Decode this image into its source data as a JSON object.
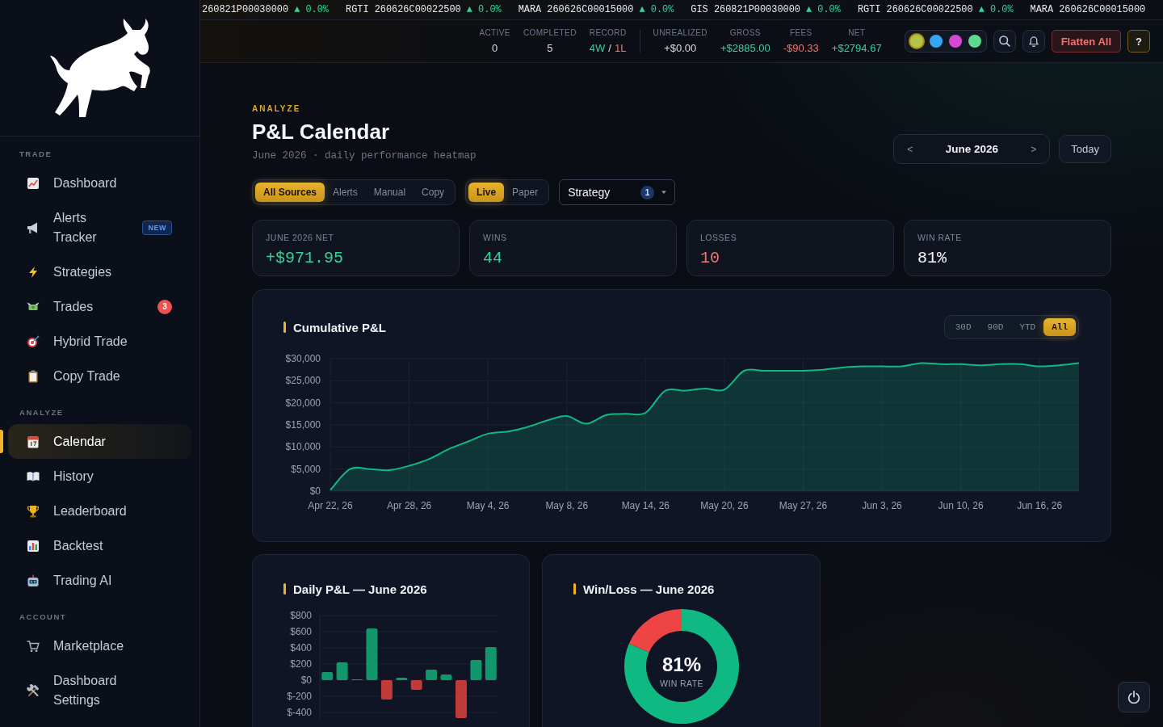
{
  "sidebar": {
    "sections": [
      {
        "title": "TRADE",
        "items": [
          {
            "label": "Dashboard",
            "selected": false
          },
          {
            "label": "Alerts Tracker",
            "selected": false,
            "badge": {
              "kind": "new",
              "text": "NEW"
            }
          },
          {
            "label": "Strategies",
            "selected": false
          },
          {
            "label": "Trades",
            "selected": false,
            "badge": {
              "kind": "count",
              "text": "3"
            }
          },
          {
            "label": "Hybrid Trade",
            "selected": false
          },
          {
            "label": "Copy Trade",
            "selected": false
          }
        ]
      },
      {
        "title": "ANALYZE",
        "items": [
          {
            "label": "Calendar",
            "selected": true
          },
          {
            "label": "History",
            "selected": false
          },
          {
            "label": "Leaderboard",
            "selected": false
          },
          {
            "label": "Backtest",
            "selected": false
          },
          {
            "label": "Trading AI",
            "selected": false
          }
        ]
      },
      {
        "title": "ACCOUNT",
        "items": [
          {
            "label": "Marketplace",
            "selected": false
          },
          {
            "label": "Dashboard Settings",
            "selected": false
          }
        ]
      }
    ]
  },
  "ticker": [
    {
      "label": "260821P00030000",
      "change": "▲ 0.0%"
    },
    {
      "label": "RGTI 260626C00022500",
      "change": "▲ 0.0%"
    },
    {
      "label": "MARA 260626C00015000",
      "change": "▲ 0.0%"
    },
    {
      "label": "GIS 260821P00030000",
      "change": "▲ 0.0%"
    },
    {
      "label": "RGTI 260626C00022500",
      "change": "▲ 0.0%"
    },
    {
      "label": "MARA 260626C00015000"
    }
  ],
  "header_stats": {
    "counts": [
      {
        "label": "ACTIVE",
        "value": "0"
      },
      {
        "label": "COMPLETED",
        "value": "5"
      },
      {
        "label": "RECORD",
        "parts": [
          {
            "text": "4W",
            "color": "#34d399"
          },
          {
            "text": "/"
          },
          {
            "text": "1L",
            "color": "#f87171"
          }
        ]
      }
    ],
    "pnl": [
      {
        "label": "UNREALIZED",
        "value": "+$0.00"
      },
      {
        "label": "GROSS",
        "value": "+$2885.00",
        "color": "#34d399"
      },
      {
        "label": "FEES",
        "value": "-$90.33",
        "color": "#f87171"
      },
      {
        "label": "NET",
        "value": "+$2794.67",
        "color": "#34d399"
      }
    ]
  },
  "theme_swatches": [
    {
      "color": "#b3c44a",
      "selected": true
    },
    {
      "color": "#38a6f2",
      "selected": false
    },
    {
      "color": "#d548d6",
      "selected": false
    },
    {
      "color": "#5fd98f",
      "selected": false
    }
  ],
  "header_actions": {
    "flatten": "Flatten All",
    "help": "?"
  },
  "page": {
    "eyebrow": "ANALYZE",
    "title": "P&L Calendar",
    "subtitle": "June 2026 · daily performance heatmap"
  },
  "month_nav": {
    "prev": "<",
    "label": "June 2026",
    "next": ">",
    "today": "Today"
  },
  "source_filter": [
    {
      "label": "All Sources",
      "selected": true
    },
    {
      "label": "Alerts",
      "selected": false
    },
    {
      "label": "Manual",
      "selected": false
    },
    {
      "label": "Copy",
      "selected": false
    }
  ],
  "mode_filter": [
    {
      "label": "Live",
      "selected": true
    },
    {
      "label": "Paper",
      "selected": false
    }
  ],
  "strategy_select": {
    "label": "Strategy",
    "count": "1"
  },
  "kpis": [
    {
      "label": "JUNE 2026 NET",
      "value": "+$971.95",
      "color": "#34d399"
    },
    {
      "label": "WINS",
      "value": "44",
      "color": "#34d399"
    },
    {
      "label": "LOSSES",
      "value": "10",
      "color": "#f87171"
    },
    {
      "label": "WIN RATE",
      "value": "81%",
      "color": "#f4f6f9"
    }
  ],
  "cumulative_chart": {
    "title": "Cumulative P&L",
    "ranges": [
      {
        "label": "30D",
        "selected": false
      },
      {
        "label": "90D",
        "selected": false
      },
      {
        "label": "YTD",
        "selected": false
      },
      {
        "label": "All",
        "selected": true
      }
    ],
    "chart_data": {
      "type": "area",
      "grid": true,
      "categories": [
        "Apr 22, 26",
        null,
        null,
        null,
        "Apr 28, 26",
        null,
        null,
        null,
        "May 4, 26",
        null,
        null,
        null,
        "May 8, 26",
        null,
        null,
        null,
        "May 14, 26",
        null,
        null,
        null,
        "May 20, 26",
        null,
        null,
        null,
        "May 27, 26",
        null,
        null,
        null,
        "Jun 3, 26",
        null,
        null,
        null,
        "Jun 10, 26",
        null,
        null,
        null,
        "Jun 16, 26",
        null,
        null
      ],
      "ylim": [
        0,
        30000
      ],
      "yticks": [
        {
          "value": 0,
          "label": "$0"
        },
        {
          "value": 5000,
          "label": "$5,000"
        },
        {
          "value": 10000,
          "label": "$10,000"
        },
        {
          "value": 15000,
          "label": "$15,000"
        },
        {
          "value": 20000,
          "label": "$20,000"
        },
        {
          "value": 25000,
          "label": "$25,000"
        },
        {
          "value": 30000,
          "label": "$30,000"
        }
      ],
      "series": [
        {
          "color": "#10b981",
          "values": [
            250,
            5000,
            5000,
            4750,
            5750,
            7250,
            9500,
            11250,
            13000,
            13500,
            14500,
            16000,
            17000,
            15250,
            17250,
            17500,
            17750,
            22750,
            22750,
            23250,
            23000,
            27250,
            27250,
            27250,
            27250,
            27500,
            28000,
            28250,
            28250,
            28250,
            29000,
            28750,
            28750,
            28500,
            28750,
            28750,
            28250,
            28500,
            29000
          ]
        }
      ]
    }
  },
  "daily_chart": {
    "title": "Daily P&L — June 2026",
    "chart_data": {
      "type": "bar",
      "grid": true,
      "ylim": [
        -480,
        800
      ],
      "yticks": [
        {
          "value": 800,
          "label": "$800"
        },
        {
          "value": 600,
          "label": "$600"
        },
        {
          "value": 400,
          "label": "$400"
        },
        {
          "value": 200,
          "label": "$200"
        },
        {
          "value": 0,
          "label": "$0"
        },
        {
          "value": -200,
          "label": "$-200"
        },
        {
          "value": -400,
          "label": "$-400"
        }
      ],
      "values": [
        100,
        220,
        10,
        640,
        -240,
        30,
        -120,
        130,
        70,
        -470,
        250,
        410
      ]
    }
  },
  "win_loss": {
    "title": "Win/Loss — June 2026",
    "center_value": "81%",
    "center_label": "WIN RATE",
    "chart_data": {
      "type": "donut",
      "values": [
        81.5,
        18.5
      ]
    }
  }
}
